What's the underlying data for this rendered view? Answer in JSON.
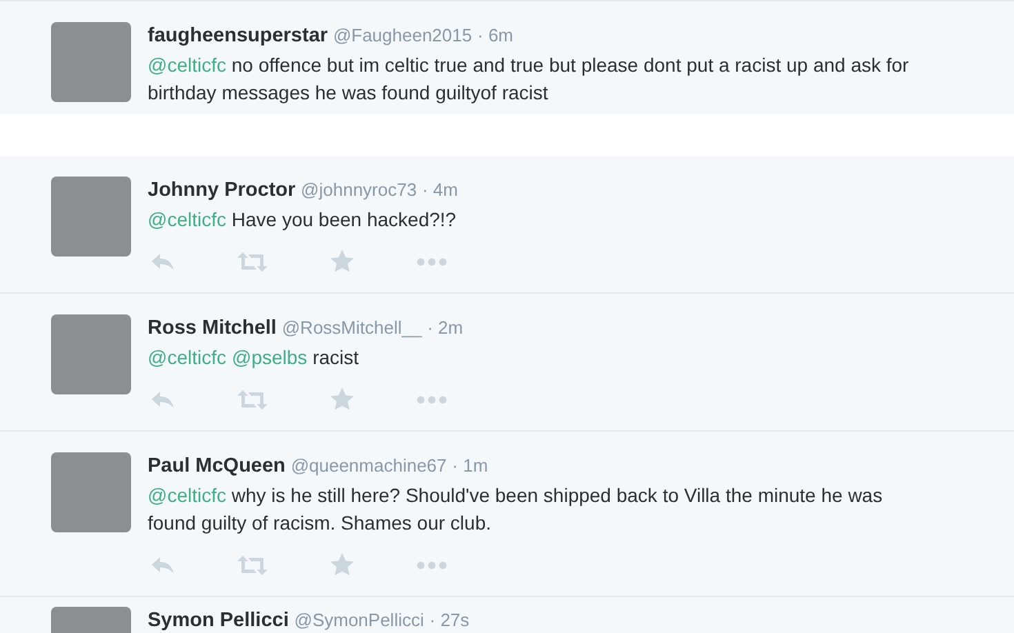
{
  "tweets": [
    {
      "kind": "original",
      "name": "faugheensuperstar",
      "handle": "@Faugheen2015",
      "time": "· 6m",
      "text": [
        {
          "kind": "mention",
          "text": "@celticfc"
        },
        {
          "kind": "plain",
          "text": " no offence but im celtic true and true but please dont put a racist up and ask for birthday messages he was found guiltyof racist"
        }
      ]
    },
    {
      "kind": "reply",
      "name": "Johnny Proctor",
      "handle": "@johnnyroc73",
      "time": "· 4m",
      "text": [
        {
          "kind": "mention",
          "text": "@celticfc"
        },
        {
          "kind": "plain",
          "text": " Have you been hacked?!?"
        }
      ]
    },
    {
      "kind": "reply",
      "name": "Ross Mitchell",
      "handle": "@RossMitchell__",
      "time": "· 2m",
      "text": [
        {
          "kind": "mention",
          "text": "@celticfc"
        },
        {
          "kind": "mention",
          "text": "@pselbs"
        },
        {
          "kind": "plain",
          "text": " racist"
        }
      ]
    },
    {
      "kind": "reply",
      "name": "Paul McQueen",
      "handle": "@queenmachine67",
      "time": "· 1m",
      "text": [
        {
          "kind": "mention",
          "text": "@celticfc"
        },
        {
          "kind": "plain",
          "text": " why is he still here? Should've been shipped back to Villa the minute he was found guilty of racism. Shames our club."
        }
      ]
    },
    {
      "kind": "partial",
      "name": "Symon Pellicci",
      "handle": "@SymonPellicci",
      "time": "· 27s"
    }
  ]
}
